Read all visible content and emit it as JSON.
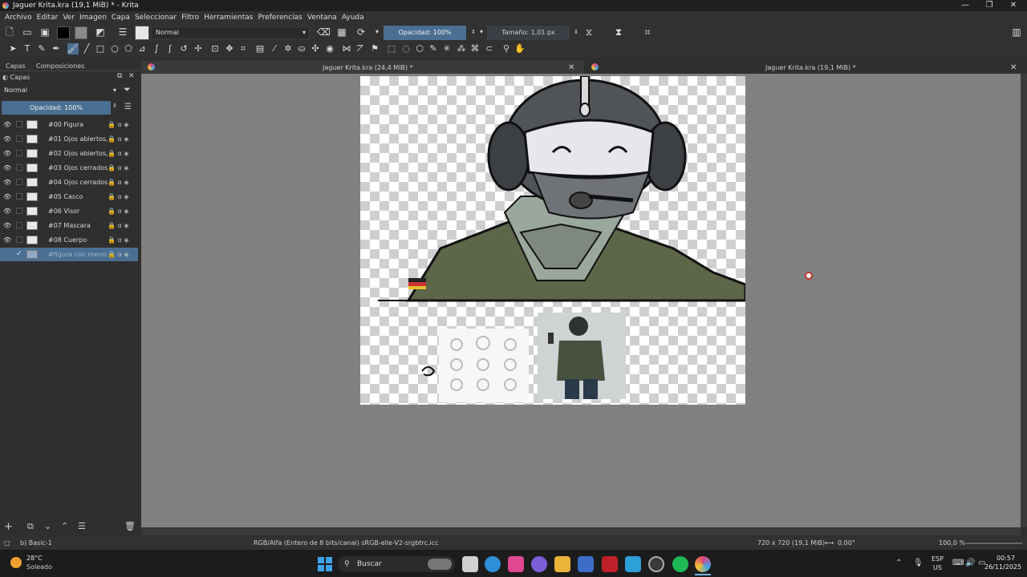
{
  "window": {
    "title": "Jaguer Krita.kra (19,1 MiB) * - Krita"
  },
  "menu": [
    "Archivo",
    "Editar",
    "Ver",
    "Imagen",
    "Capa",
    "Seleccionar",
    "Filtro",
    "Herramientas",
    "Preferencias",
    "Ventana",
    "Ayuda"
  ],
  "toolbar": {
    "blend_mode": "Normal",
    "opacity": "Opacidad: 100%",
    "size": "Tamaño: 1,01 px"
  },
  "docker": {
    "tabs": [
      "Capas",
      "Composiciones"
    ],
    "title": "Capas",
    "blend_mode": "Normal",
    "opacity": "Opacidad:  100%",
    "layers": [
      {
        "name": "#00 Figura"
      },
      {
        "name": "#01 Ojos abiertos,..."
      },
      {
        "name": "#02 Ojos abiertos,..."
      },
      {
        "name": "#03 Ojos cerrados,..."
      },
      {
        "name": "#04 Ojos cerrados,..."
      },
      {
        "name": "#05 Casco"
      },
      {
        "name": "#06 Visor"
      },
      {
        "name": "#07 Mascara"
      },
      {
        "name": "#08 Cuerpo"
      },
      {
        "name": "#figura con meno..."
      }
    ]
  },
  "documents": {
    "tab1": "Jaguer Krita.kra (24,4 MiB) *",
    "tab2": "Jaguer Krita.kra (19,1 MiB) *"
  },
  "status": {
    "brush": "b) Basic-1",
    "colorspace": "RGB/Alfa (Entero de 8 bits/canal)  sRGB-elle-V2-srgbtrc.icc",
    "dimensions": "720 x 720 (19,1 MiB)",
    "rotation": "0,00°",
    "zoom": "100,0 %"
  },
  "taskbar": {
    "temp": "28°C",
    "weather": "Soleado",
    "search": "Buscar",
    "lang1": "ESP",
    "lang2": "US",
    "time": "00:57",
    "date": "26/11/2025"
  }
}
